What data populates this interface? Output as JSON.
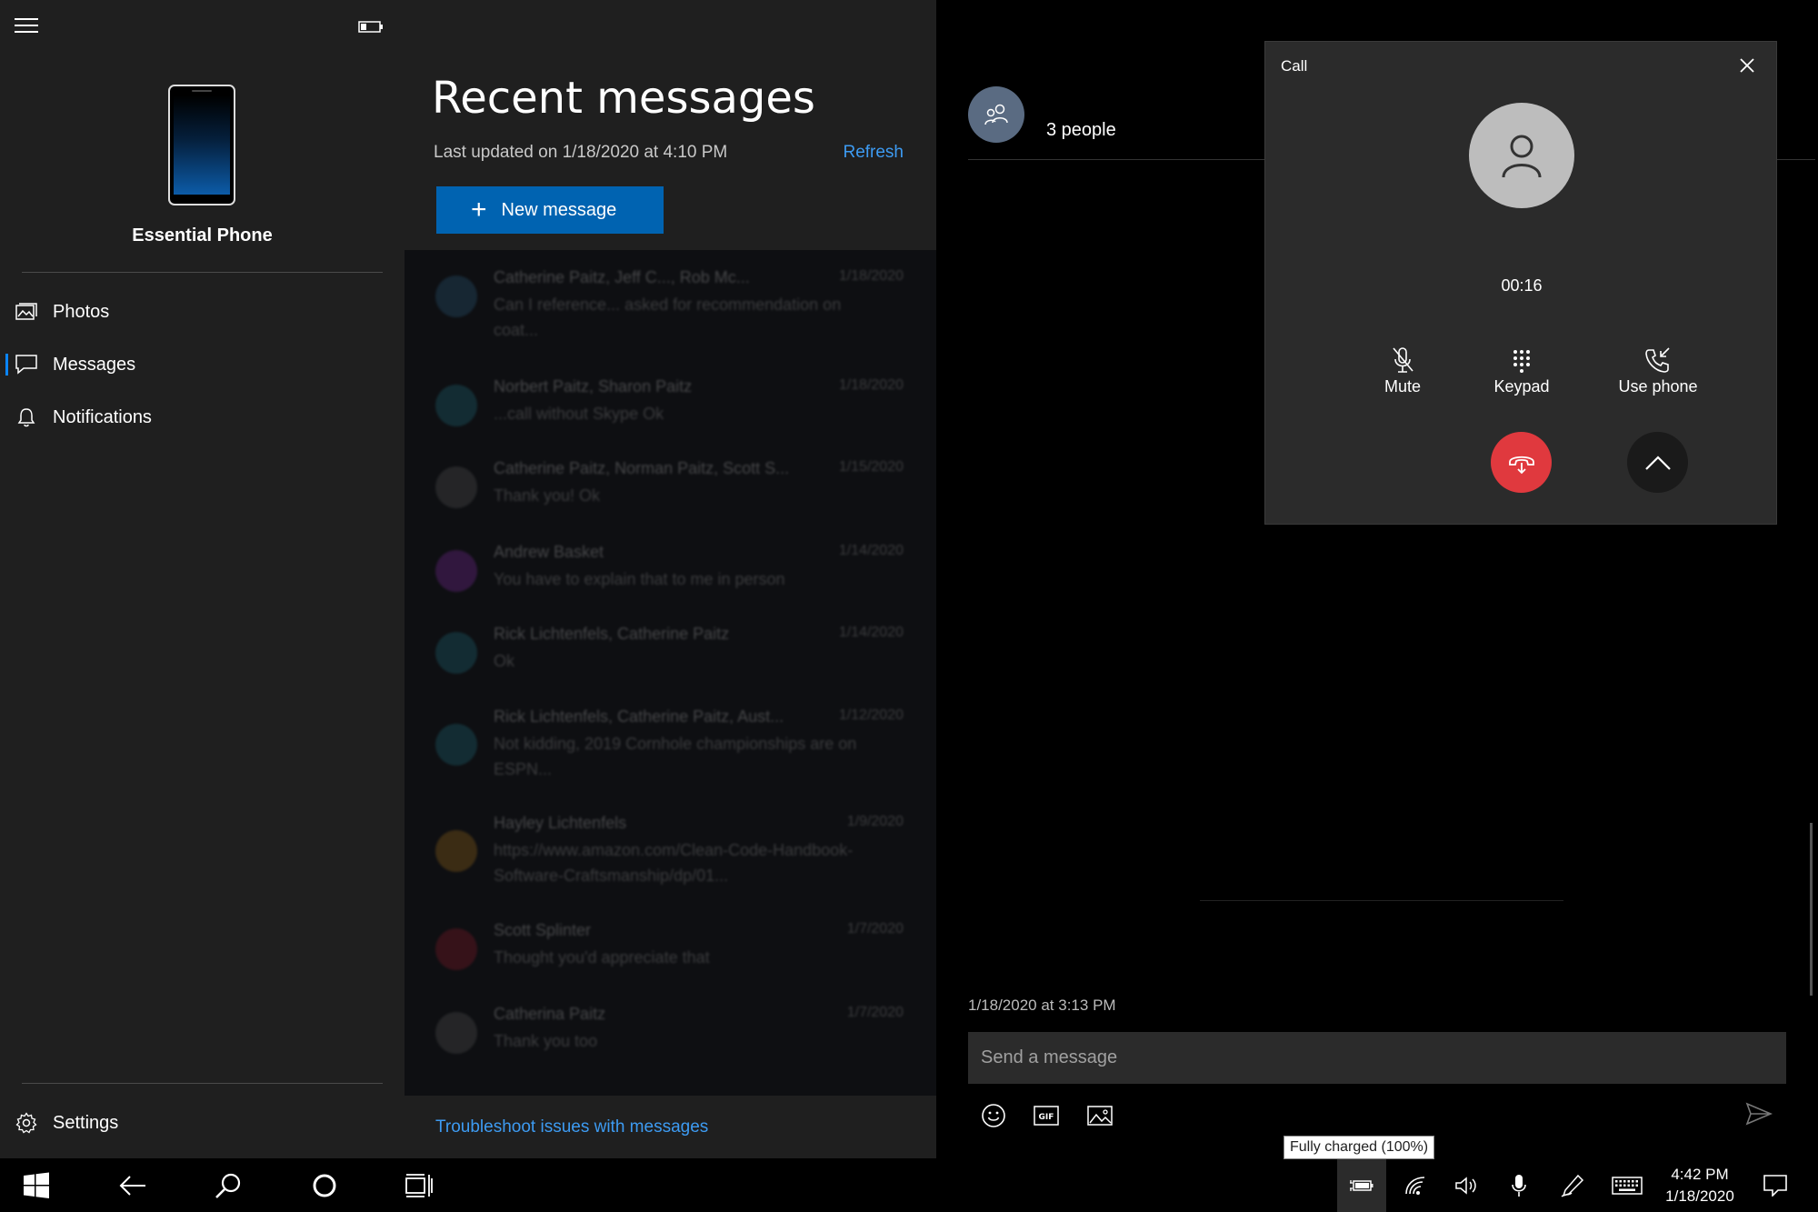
{
  "sidebar": {
    "device_name": "Essential Phone",
    "nav": [
      {
        "label": "Photos",
        "icon": "photos-icon"
      },
      {
        "label": "Messages",
        "icon": "message-icon",
        "active": true
      },
      {
        "label": "Notifications",
        "icon": "bell-icon"
      }
    ],
    "settings_label": "Settings"
  },
  "messages": {
    "title": "Recent messages",
    "last_updated": "Last updated on 1/18/2020 at 4:10 PM",
    "refresh_label": "Refresh",
    "new_message_label": "New message",
    "troubleshoot_label": "Troubleshoot issues with messages",
    "threads": [
      {
        "names": "Catherine Paitz, Jeff C..., Rob Mc...",
        "date": "1/18/2020",
        "preview": "Can I reference... asked for recommendation on coat...",
        "color": "#2a5a7a"
      },
      {
        "names": "Norbert Paitz, Sharon Paitz",
        "date": "1/18/2020",
        "preview": "...call without Skype Ok",
        "color": "#1f6b7a"
      },
      {
        "names": "Catherine Paitz, Norman Paitz, Scott S...",
        "date": "1/15/2020",
        "preview": "Thank you! Ok",
        "color": "#555555"
      },
      {
        "names": "Andrew Basket",
        "date": "1/14/2020",
        "preview": "You have to explain that to me in person",
        "color": "#7a2a9a"
      },
      {
        "names": "Rick Lichtenfels, Catherine Paitz",
        "date": "1/14/2020",
        "preview": "Ok",
        "color": "#1f6b7a"
      },
      {
        "names": "Rick Lichtenfels, Catherine Paitz, Aust...",
        "date": "1/12/2020",
        "preview": "Not kidding, 2019 Cornhole championships are on ESPN...",
        "color": "#1f6b7a"
      },
      {
        "names": "Hayley Lichtenfels",
        "date": "1/9/2020",
        "preview": "https://www.amazon.com/Clean-Code-Handbook-Software-Craftsmanship/dp/01...",
        "color": "#9a6a1a"
      },
      {
        "names": "Scott Splinter",
        "date": "1/7/2020",
        "preview": "Thought you'd appreciate that",
        "color": "#8a1a2a"
      },
      {
        "names": "Catherina Paitz",
        "date": "1/7/2020",
        "preview": "Thank you too",
        "color": "#555555"
      }
    ]
  },
  "conversation": {
    "participants": "3 people",
    "timestamp": "1/18/2020 at 3:13 PM",
    "input_placeholder": "Send a message"
  },
  "call": {
    "title": "Call",
    "timer": "00:16",
    "actions": {
      "mute": "Mute",
      "keypad": "Keypad",
      "use_phone": "Use phone"
    }
  },
  "tooltip": "Fully charged (100%)",
  "taskbar": {
    "time": "4:42 PM",
    "date": "1/18/2020"
  },
  "colors": {
    "accent": "#0063b1",
    "link": "#3d9bf2",
    "hangup": "#e0393e"
  }
}
